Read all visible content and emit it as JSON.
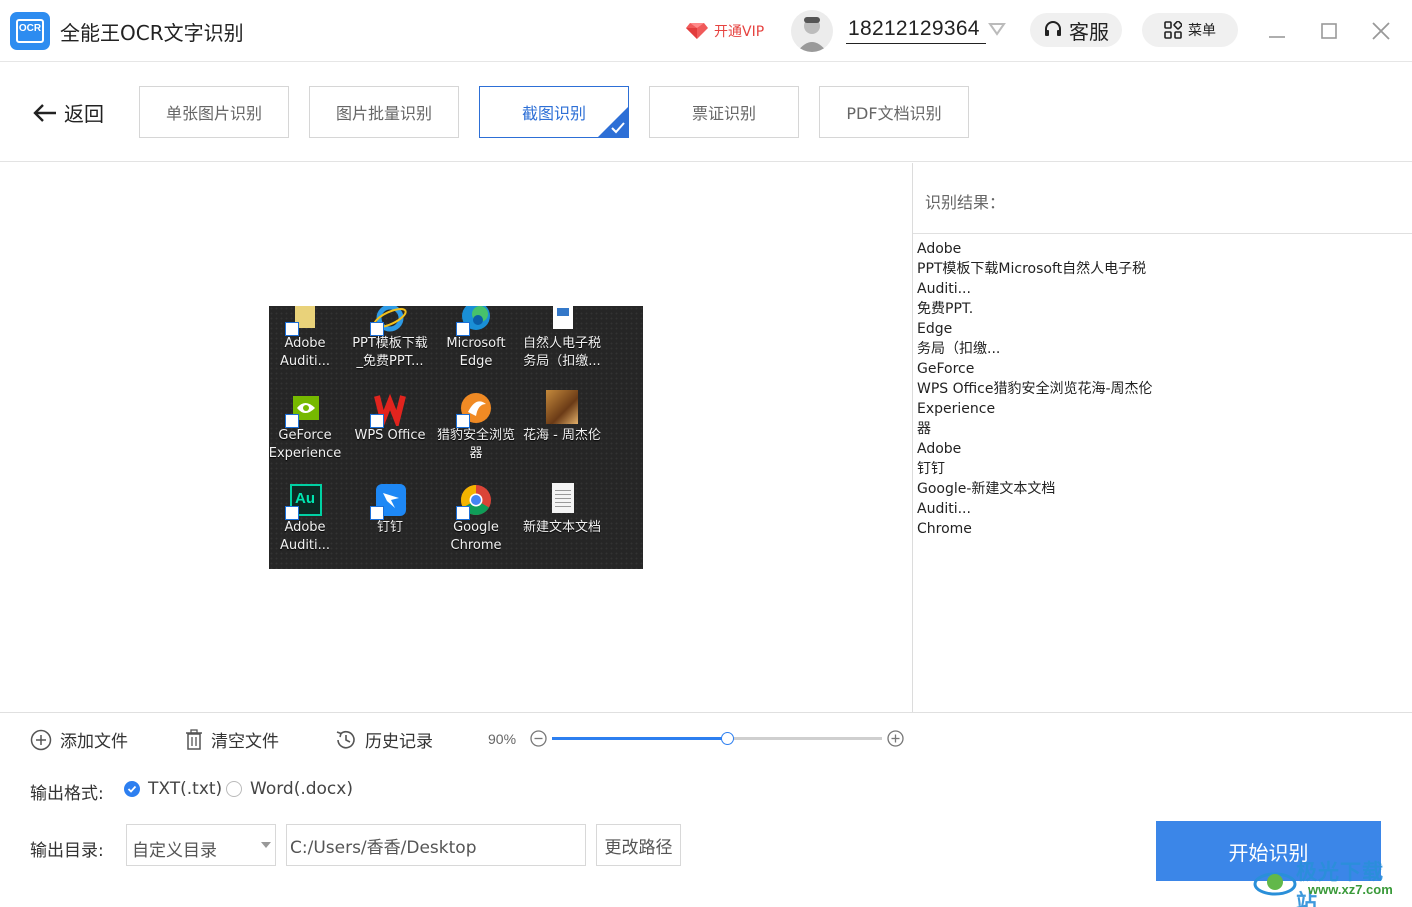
{
  "titlebar": {
    "app_icon_text": "OCR",
    "app_title": "全能王OCR文字识别",
    "vip_label": "开通VIP",
    "phone": "18212129364",
    "service_label": "客服",
    "menu_label": "菜单"
  },
  "toolbar": {
    "back_label": "返回",
    "tabs": [
      {
        "label": "单张图片识别",
        "active": false
      },
      {
        "label": "图片批量识别",
        "active": false
      },
      {
        "label": "截图识别",
        "active": true
      },
      {
        "label": "票证识别",
        "active": false
      },
      {
        "label": "PDF文档识别",
        "active": false
      }
    ]
  },
  "preview": {
    "desktop_icons": [
      {
        "line1": "Adobe",
        "line2": "Auditi...",
        "icon": "adobe-audition-icon"
      },
      {
        "line1": "PPT模板下载",
        "line2": "_免费PPT...",
        "icon": "ie-icon"
      },
      {
        "line1": "Microsoft",
        "line2": "Edge",
        "icon": "edge-icon"
      },
      {
        "line1": "自然人电子税",
        "line2": "务局（扣缴...",
        "icon": "tax-icon"
      },
      {
        "line1": "GeForce",
        "line2": "Experience",
        "icon": "geforce-icon"
      },
      {
        "line1": "WPS Office",
        "line2": "",
        "icon": "wps-icon"
      },
      {
        "line1": "猎豹安全浏览",
        "line2": "器",
        "icon": "liebao-icon"
      },
      {
        "line1": "花海 - 周杰伦",
        "line2": "",
        "icon": "music-icon"
      },
      {
        "line1": "Adobe",
        "line2": "Auditi...",
        "icon": "adobe-audition-icon"
      },
      {
        "line1": "钉钉",
        "line2": "",
        "icon": "dingtalk-icon"
      },
      {
        "line1": "Google",
        "line2": "Chrome",
        "icon": "chrome-icon"
      },
      {
        "line1": "新建文本文档",
        "line2": "",
        "icon": "text-document-icon"
      }
    ]
  },
  "result": {
    "title": "识别结果：",
    "lines": [
      "Adobe",
      "PPT模板下载Microsoft自然人电子税",
      "Auditi...",
      "免费PPT.",
      "Edge",
      "务局（扣缴...",
      "GeForce",
      "WPS Office猎豹安全浏览花海-周杰伦",
      "Experience",
      "器",
      "Adobe",
      "钉钉",
      "Google-新建文本文档",
      "Auditi...",
      "Chrome"
    ]
  },
  "bottom": {
    "add_file_label": "添加文件",
    "clear_file_label": "清空文件",
    "history_label": "历史记录",
    "zoom_label": "90%",
    "zoom_level": 0.53,
    "format_label": "输出格式:",
    "format_options": [
      {
        "label": "TXT(.txt)",
        "selected": true
      },
      {
        "label": "Word(.docx)",
        "selected": false
      }
    ],
    "dir_label": "输出目录:",
    "dir_select_value": "自定义目录",
    "path_value": "C:/Users/香香/Desktop",
    "change_path_label": "更改路径",
    "start_label": "开始识别"
  },
  "watermark": {
    "line1": "极光下载站",
    "line2": "www.xz7.com"
  },
  "colors": {
    "accent": "#3b86e8",
    "active_tab": "#2d6fd6",
    "vip": "#e64340"
  }
}
